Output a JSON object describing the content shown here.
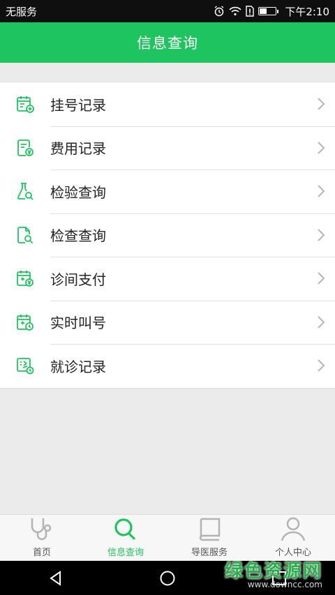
{
  "status_bar": {
    "carrier": "无服务",
    "time": "下午2:10"
  },
  "header": {
    "title": "信息查询"
  },
  "menu": {
    "items": [
      {
        "label": "挂号记录",
        "icon": "calendar-plus-icon"
      },
      {
        "label": "费用记录",
        "icon": "bill-icon"
      },
      {
        "label": "检验查询",
        "icon": "flask-search-icon"
      },
      {
        "label": "检查查询",
        "icon": "document-search-icon"
      },
      {
        "label": "诊间支付",
        "icon": "calendar-yen-icon"
      },
      {
        "label": "实时叫号",
        "icon": "calendar-clock-icon"
      },
      {
        "label": "就诊记录",
        "icon": "visit-record-icon"
      }
    ]
  },
  "tabbar": {
    "tabs": [
      {
        "label": "首页",
        "icon": "stethoscope-icon",
        "active": false
      },
      {
        "label": "信息查询",
        "icon": "search-icon",
        "active": true
      },
      {
        "label": "导医服务",
        "icon": "guide-book-icon",
        "active": false
      },
      {
        "label": "个人中心",
        "icon": "person-icon",
        "active": false
      }
    ]
  },
  "watermark": {
    "text": "绿色资源网",
    "url": "www.downcc.com"
  },
  "colors": {
    "brand": "#1ec45e",
    "background": "#ebebeb",
    "status_bar": "#0f0f0f"
  }
}
